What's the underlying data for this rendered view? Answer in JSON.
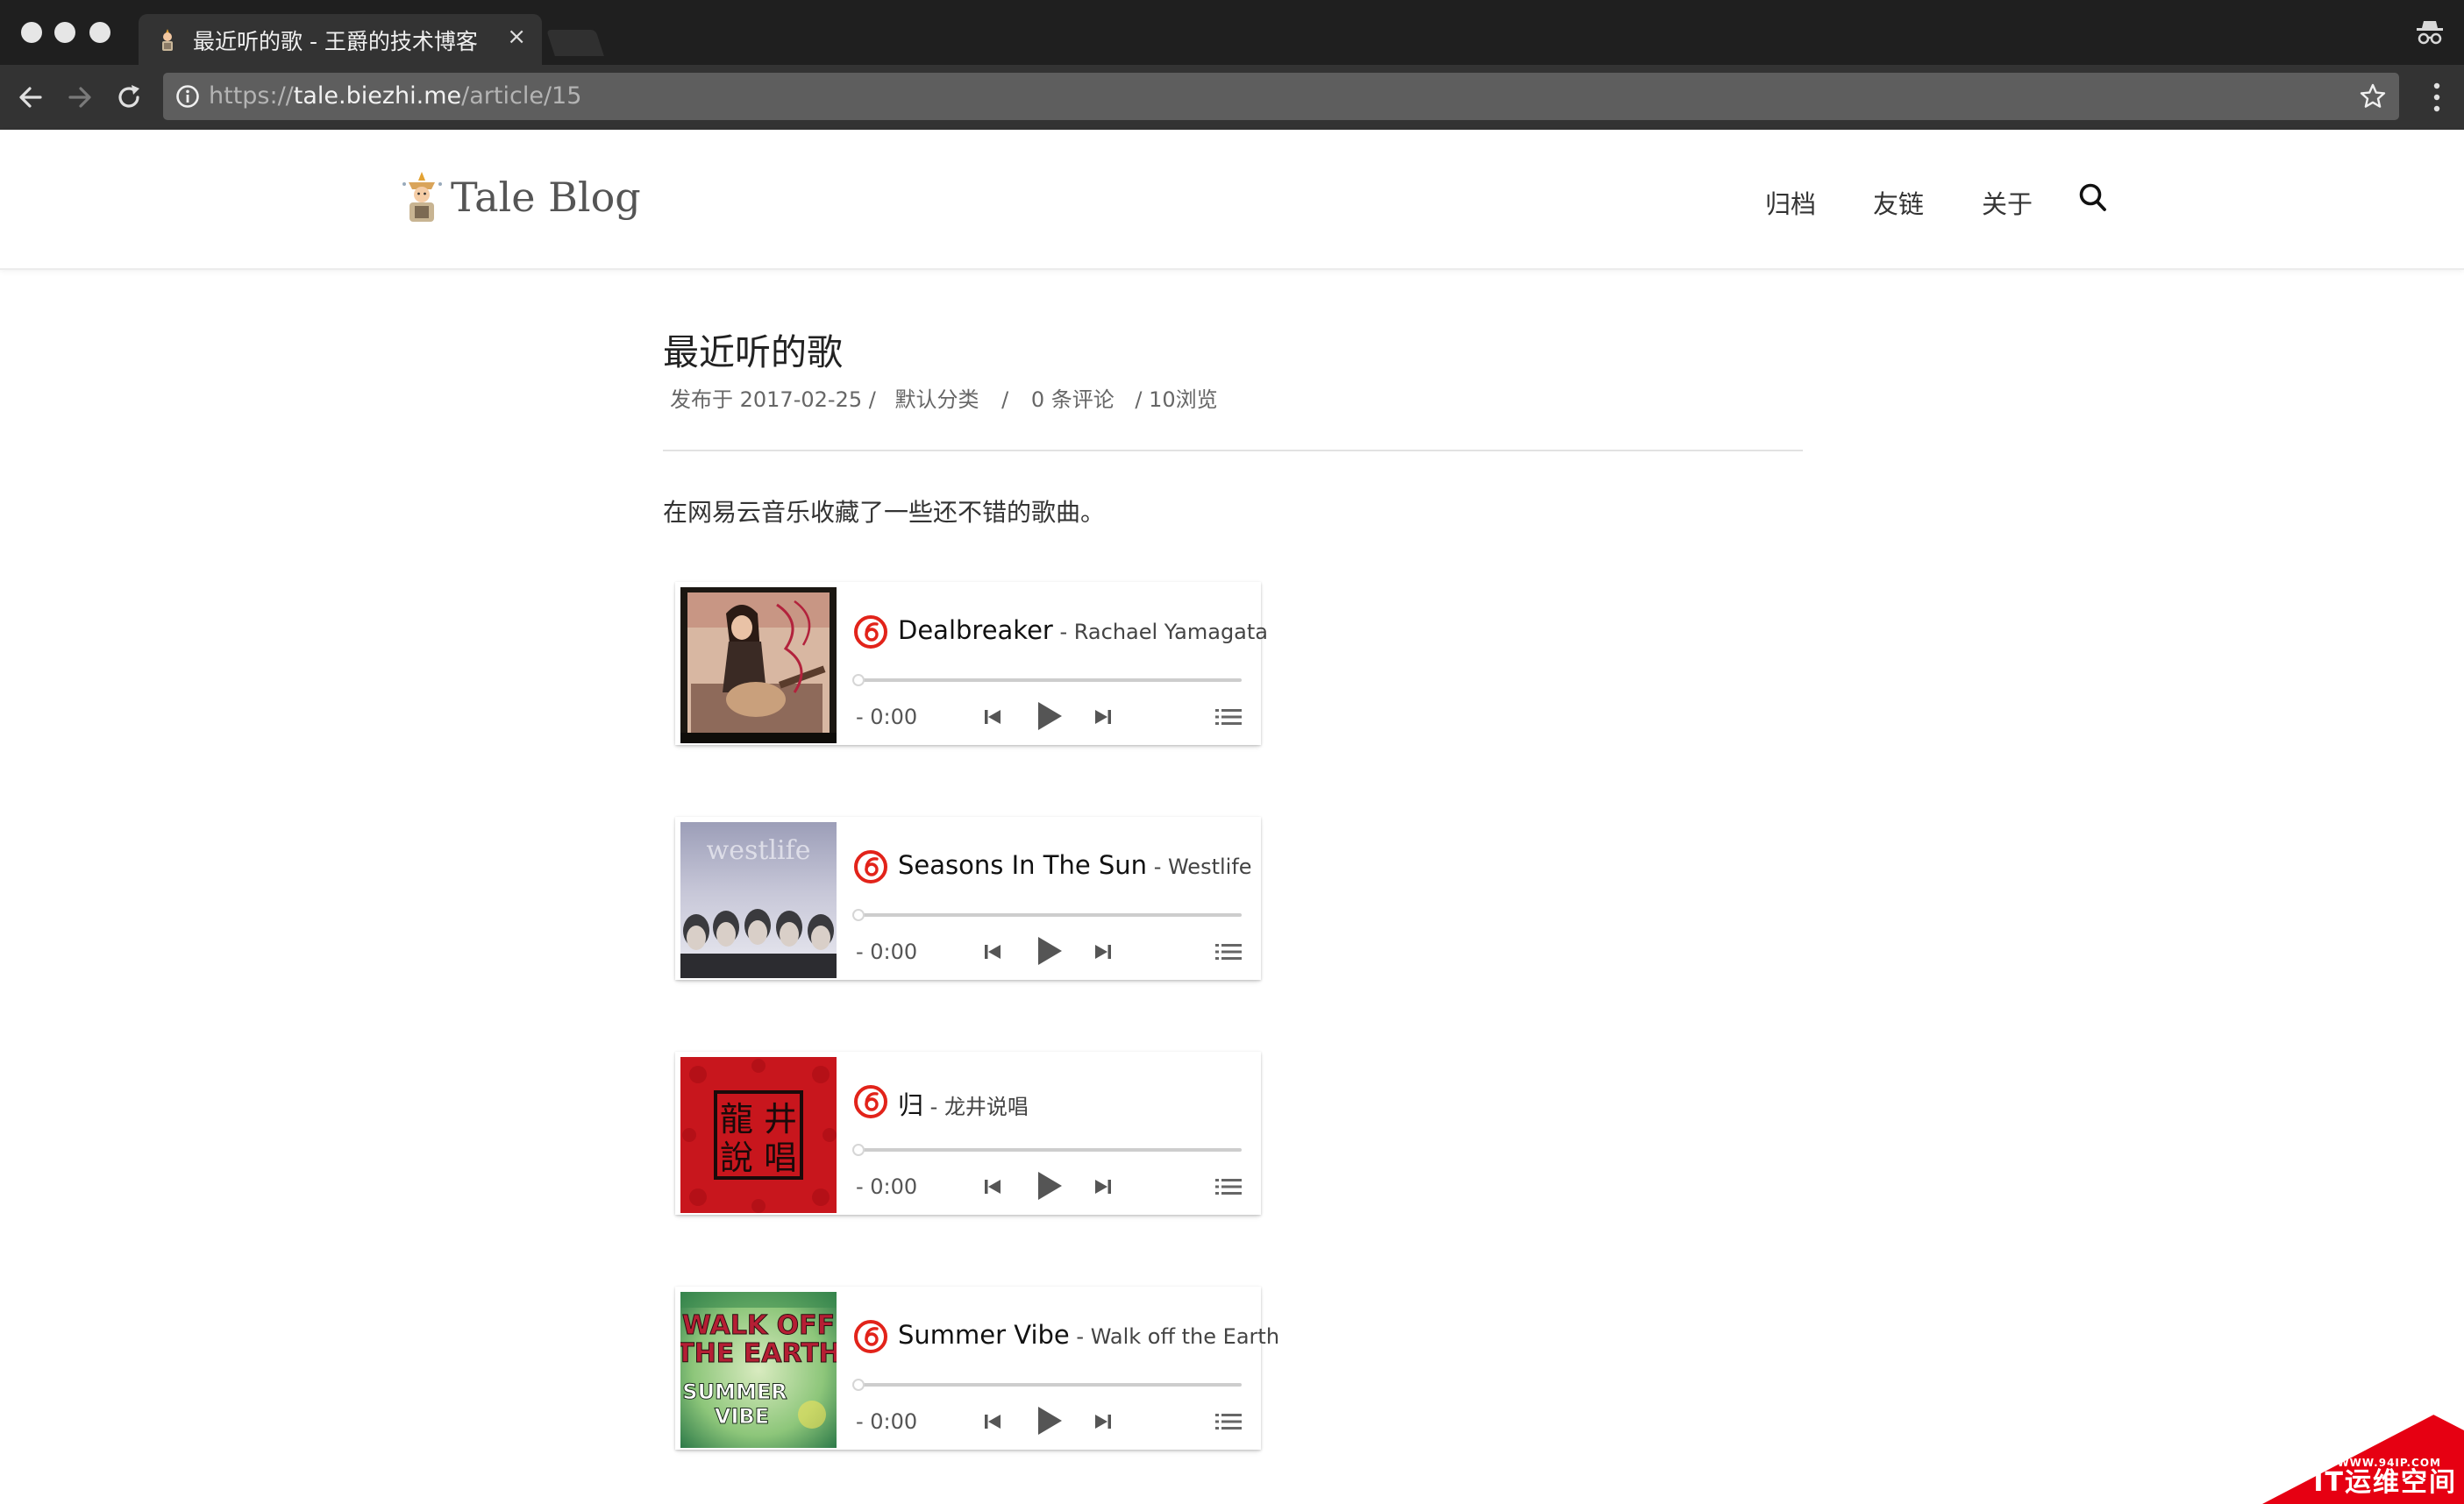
{
  "browser": {
    "tab_title": "最近听的歌 - 王爵的技术博客",
    "tab_close": "×",
    "url_scheme": "https://",
    "url_host": "tale.biezhi.me",
    "url_path": "/article/15"
  },
  "site": {
    "logo_text": "Tale Blog",
    "nav": [
      {
        "label": "归档"
      },
      {
        "label": "友链"
      },
      {
        "label": "关于"
      }
    ]
  },
  "article": {
    "title": "最近听的歌",
    "meta": {
      "published": "发布于 2017-02-25 /",
      "category": "默认分类",
      "sep": "/",
      "comments": "0 条评论",
      "views": "/ 10浏览"
    },
    "intro": "在网易云音乐收藏了一些还不错的歌曲。"
  },
  "players": [
    {
      "name": "Dealbreaker",
      "sep": " - ",
      "artist": "Rachael Yamagata",
      "time": "- 0:00",
      "progress": 0
    },
    {
      "name": "Seasons In The Sun",
      "sep": " - ",
      "artist": "Westlife",
      "time": "- 0:00",
      "progress": 0,
      "cover_text": "westlife"
    },
    {
      "name": "归",
      "sep": " - ",
      "artist": "龙井说唱",
      "time": "- 0:00",
      "progress": 0,
      "cover_text": [
        "龍",
        "井",
        "說",
        "唱"
      ]
    },
    {
      "name": "Summer Vibe",
      "sep": " - ",
      "artist": "Walk off the Earth",
      "time": "- 0:00",
      "progress": 0,
      "cover_text": [
        "WALK OFF",
        "THE EARTH",
        "SUMMER",
        "VIBE"
      ]
    }
  ],
  "watermark": {
    "small": "WWW.94IP.COM",
    "big": "IT运维空间"
  },
  "colors": {
    "netease_red": "#e2231a",
    "chrome_dark": "#1f1f1f",
    "chrome_toolbar": "#333333"
  },
  "icons": [
    "back-icon",
    "forward-icon",
    "reload-icon",
    "info-icon",
    "star-icon",
    "menu-icon",
    "incognito-icon",
    "search-icon",
    "netease-icon",
    "prev-icon",
    "play-icon",
    "next-icon",
    "list-icon"
  ]
}
